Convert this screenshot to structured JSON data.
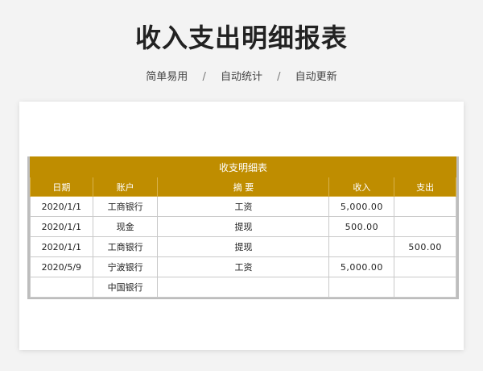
{
  "header": {
    "title": "收入支出明细报表",
    "tags": [
      "简单易用",
      "自动统计",
      "自动更新"
    ],
    "separator": "/"
  },
  "table": {
    "caption": "收支明细表",
    "columns": [
      "日期",
      "账户",
      "摘 要",
      "收入",
      "支出"
    ],
    "rows": [
      [
        "2020/1/1",
        "工商银行",
        "工资",
        "5,000.00",
        ""
      ],
      [
        "2020/1/1",
        "现金",
        "提现",
        "500.00",
        ""
      ],
      [
        "2020/1/1",
        "工商银行",
        "提现",
        "",
        "500.00"
      ],
      [
        "2020/5/9",
        "宁波银行",
        "工资",
        "5,000.00",
        ""
      ],
      [
        "",
        "中国银行",
        "",
        "",
        ""
      ]
    ]
  },
  "colors": {
    "header_bg": "#bf8d00",
    "page_bg": "#f3f3f3"
  }
}
